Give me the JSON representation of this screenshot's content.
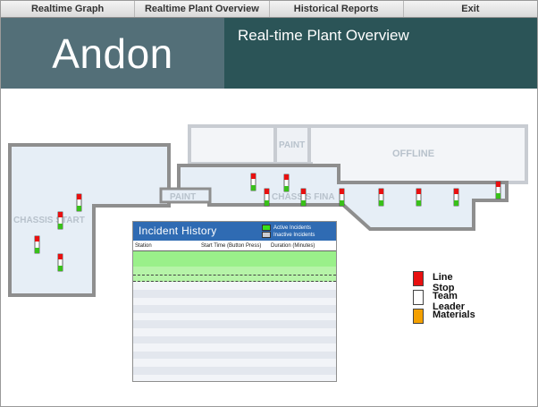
{
  "nav": {
    "items": [
      "Realtime Graph",
      "Realtime Plant Overview",
      "Historical Reports",
      "Exit"
    ]
  },
  "header": {
    "app_title": "Andon",
    "page_title": "Real-time Plant Overview"
  },
  "map": {
    "zones": {
      "paint_top": "PAINT",
      "offline": "OFFLINE",
      "paint_left": "PAINT",
      "chassis_final": "CHASSIS FINA",
      "chassis_start": "CHASSIS START"
    }
  },
  "incident_history": {
    "title": "Incident History",
    "legend": {
      "active": "Active Incidents",
      "inactive": "Inactive Incidents"
    },
    "columns": [
      "Station",
      "Start Time (Button Press)",
      "Duration (Minutes)"
    ]
  },
  "status_legend": {
    "items": [
      {
        "label": "Line Stop",
        "color": "#e81010"
      },
      {
        "label": "Team Leader",
        "color": "#ffffff"
      },
      {
        "label": "Materials",
        "color": "#f4a000"
      }
    ]
  },
  "colors": {
    "header_left": "#536f78",
    "header_right": "#2b5457",
    "panel_header": "#2f6bb3",
    "active_row": "#9af08a",
    "zone_fill": "#e6eef6",
    "zone_border": "#8e8e8e"
  }
}
